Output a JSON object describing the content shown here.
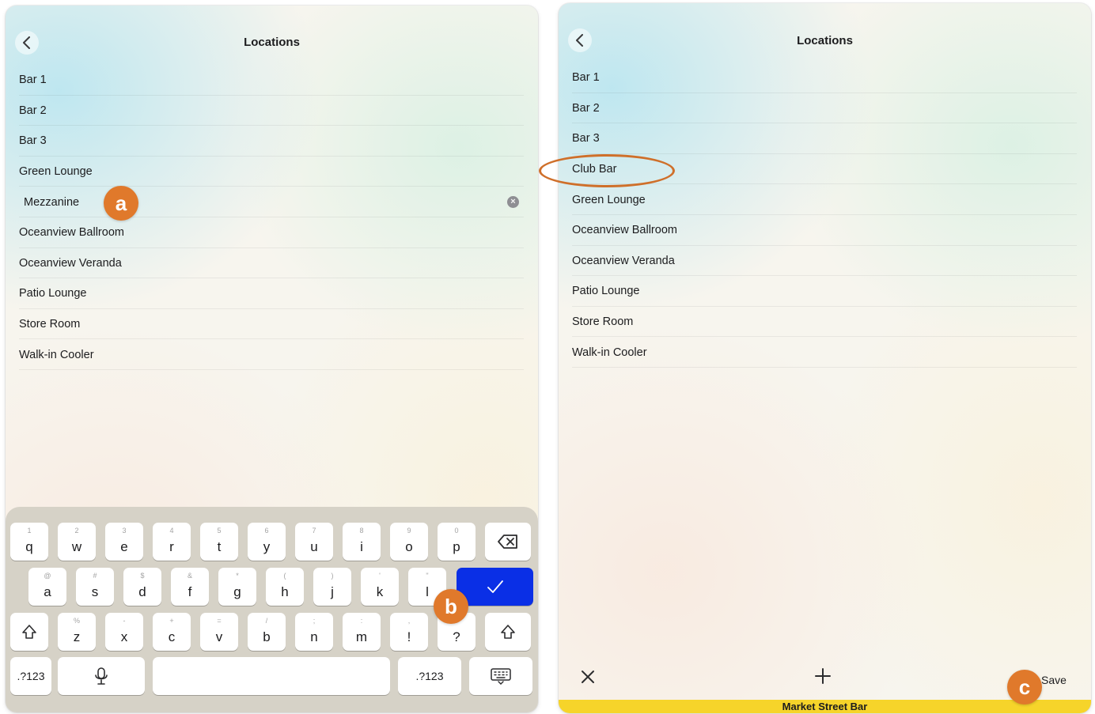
{
  "left": {
    "title": "Locations",
    "items": [
      "Bar 1",
      "Bar 2",
      "Bar 3",
      "Green Lounge",
      "Mezzanine",
      "Oceanview Ballroom",
      "Oceanview Veranda",
      "Patio Lounge",
      "Store Room",
      "Walk-in Cooler"
    ],
    "editing_index": 4
  },
  "right": {
    "title": "Locations",
    "items": [
      "Bar 1",
      "Bar 2",
      "Bar 3",
      "Club Bar",
      "Green Lounge",
      "Oceanview Ballroom",
      "Oceanview Veranda",
      "Patio Lounge",
      "Store Room",
      "Walk-in Cooler"
    ],
    "highlighted_item": "Club Bar",
    "toolbar": {
      "close_icon": "close-icon",
      "add_icon": "plus-icon",
      "save_label": "Save"
    },
    "footer_label": "Market Street Bar"
  },
  "badges": {
    "a": "a",
    "b": "b",
    "c": "c"
  },
  "keyboard": {
    "row1": [
      {
        "key": "q",
        "hint": "1"
      },
      {
        "key": "w",
        "hint": "2"
      },
      {
        "key": "e",
        "hint": "3"
      },
      {
        "key": "r",
        "hint": "4"
      },
      {
        "key": "t",
        "hint": "5"
      },
      {
        "key": "y",
        "hint": "6"
      },
      {
        "key": "u",
        "hint": "7"
      },
      {
        "key": "i",
        "hint": "8"
      },
      {
        "key": "o",
        "hint": "9"
      },
      {
        "key": "p",
        "hint": "0"
      }
    ],
    "row2": [
      {
        "key": "a",
        "hint": "@"
      },
      {
        "key": "s",
        "hint": "#"
      },
      {
        "key": "d",
        "hint": "$"
      },
      {
        "key": "f",
        "hint": "&"
      },
      {
        "key": "g",
        "hint": "*"
      },
      {
        "key": "h",
        "hint": "("
      },
      {
        "key": "j",
        "hint": ")"
      },
      {
        "key": "k",
        "hint": "'"
      },
      {
        "key": "l",
        "hint": "\""
      }
    ],
    "row3": [
      {
        "key": "z",
        "hint": "%"
      },
      {
        "key": "x",
        "hint": "-"
      },
      {
        "key": "c",
        "hint": "+"
      },
      {
        "key": "v",
        "hint": "="
      },
      {
        "key": "b",
        "hint": "/"
      },
      {
        "key": "n",
        "hint": ";"
      },
      {
        "key": "m",
        "hint": ":"
      },
      {
        "key": "!",
        "hint": ","
      },
      {
        "key": "?",
        "hint": "."
      }
    ],
    "numbers_label": ".?123",
    "done_icon": "checkmark-icon",
    "delete_icon": "backspace-icon",
    "shift_icon": "shift-icon",
    "mic_icon": "microphone-icon",
    "hide_icon": "keyboard-hide-icon",
    "accent": "#0a2fe6"
  }
}
